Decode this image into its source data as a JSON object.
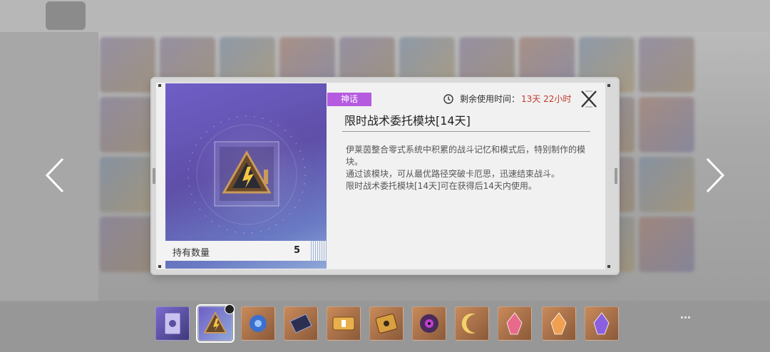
{
  "item": {
    "rarity": "神话",
    "name": "限时战术委托模块[14天]",
    "timer_label": "剩余使用时间：",
    "timer_value": "13天 22小时",
    "description": [
      "伊莱茵整合零式系统中积累的战斗记忆和模式后，特别制作的模块。",
      "通过该模块，可从最优路径突破卡厄思，迅速结束战斗。",
      "限时战术委托模块[14天]可在获得后14天内使用。"
    ],
    "quantity_label": "持有数量",
    "quantity": "5"
  },
  "icons": {
    "close": "close-icon",
    "timer": "clock-icon",
    "prev": "chevron-left-icon",
    "next": "chevron-right-icon"
  },
  "colors": {
    "rarity_badge": "#b55be0",
    "timer_value": "#c0392b"
  },
  "thumbnails": [
    {
      "name": "card-item-icon"
    },
    {
      "name": "tactical-module-icon",
      "selected": true
    },
    {
      "name": "blue-flower-icon"
    },
    {
      "name": "dark-tablet-icon"
    },
    {
      "name": "gold-ticket-icon"
    },
    {
      "name": "gold-chip-icon"
    },
    {
      "name": "purple-eye-orb-icon"
    },
    {
      "name": "crescent-moon-icon"
    },
    {
      "name": "pink-crystal-icon"
    },
    {
      "name": "orange-crystal-icon"
    },
    {
      "name": "purple-crystal-icon"
    }
  ]
}
